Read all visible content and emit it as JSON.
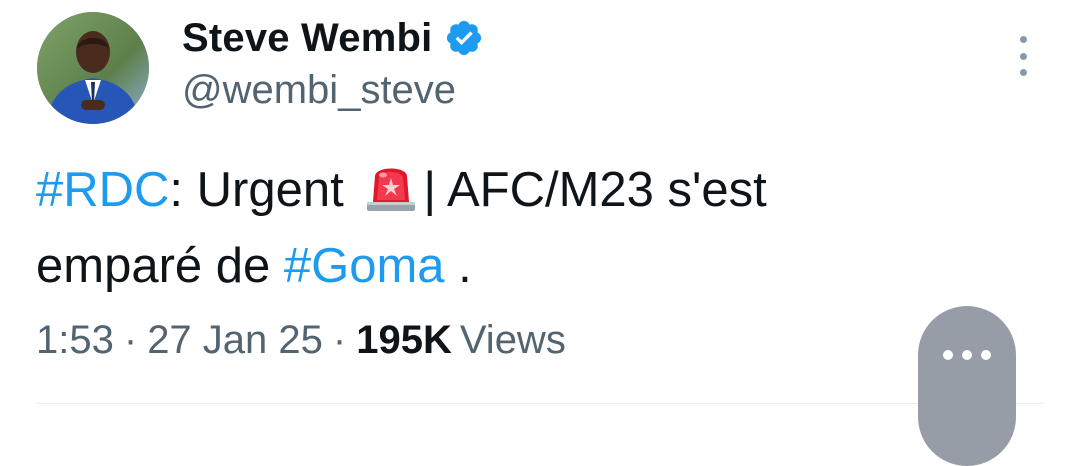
{
  "author": {
    "display_name": "Steve Wembi",
    "handle": "@wembi_steve",
    "verified": true,
    "verified_color": "#1d9bf0"
  },
  "tweet": {
    "line1": {
      "hashtag": "#RDC",
      "text_a": ": Urgent",
      "emoji": "police-car-light-icon",
      "text_b": "| AFC/M23 s'est"
    },
    "line2": {
      "text_a": "emparé de ",
      "hashtag": "#Goma",
      "text_b": " ."
    },
    "link_color": "#1d9bf0"
  },
  "meta": {
    "time": "1:53",
    "separator": "·",
    "date": "27 Jan 25",
    "views_count": "195K",
    "views_label": "Views"
  },
  "icons": {
    "more": "more-vertical-icon",
    "floating_more": "more-horizontal-icon"
  }
}
